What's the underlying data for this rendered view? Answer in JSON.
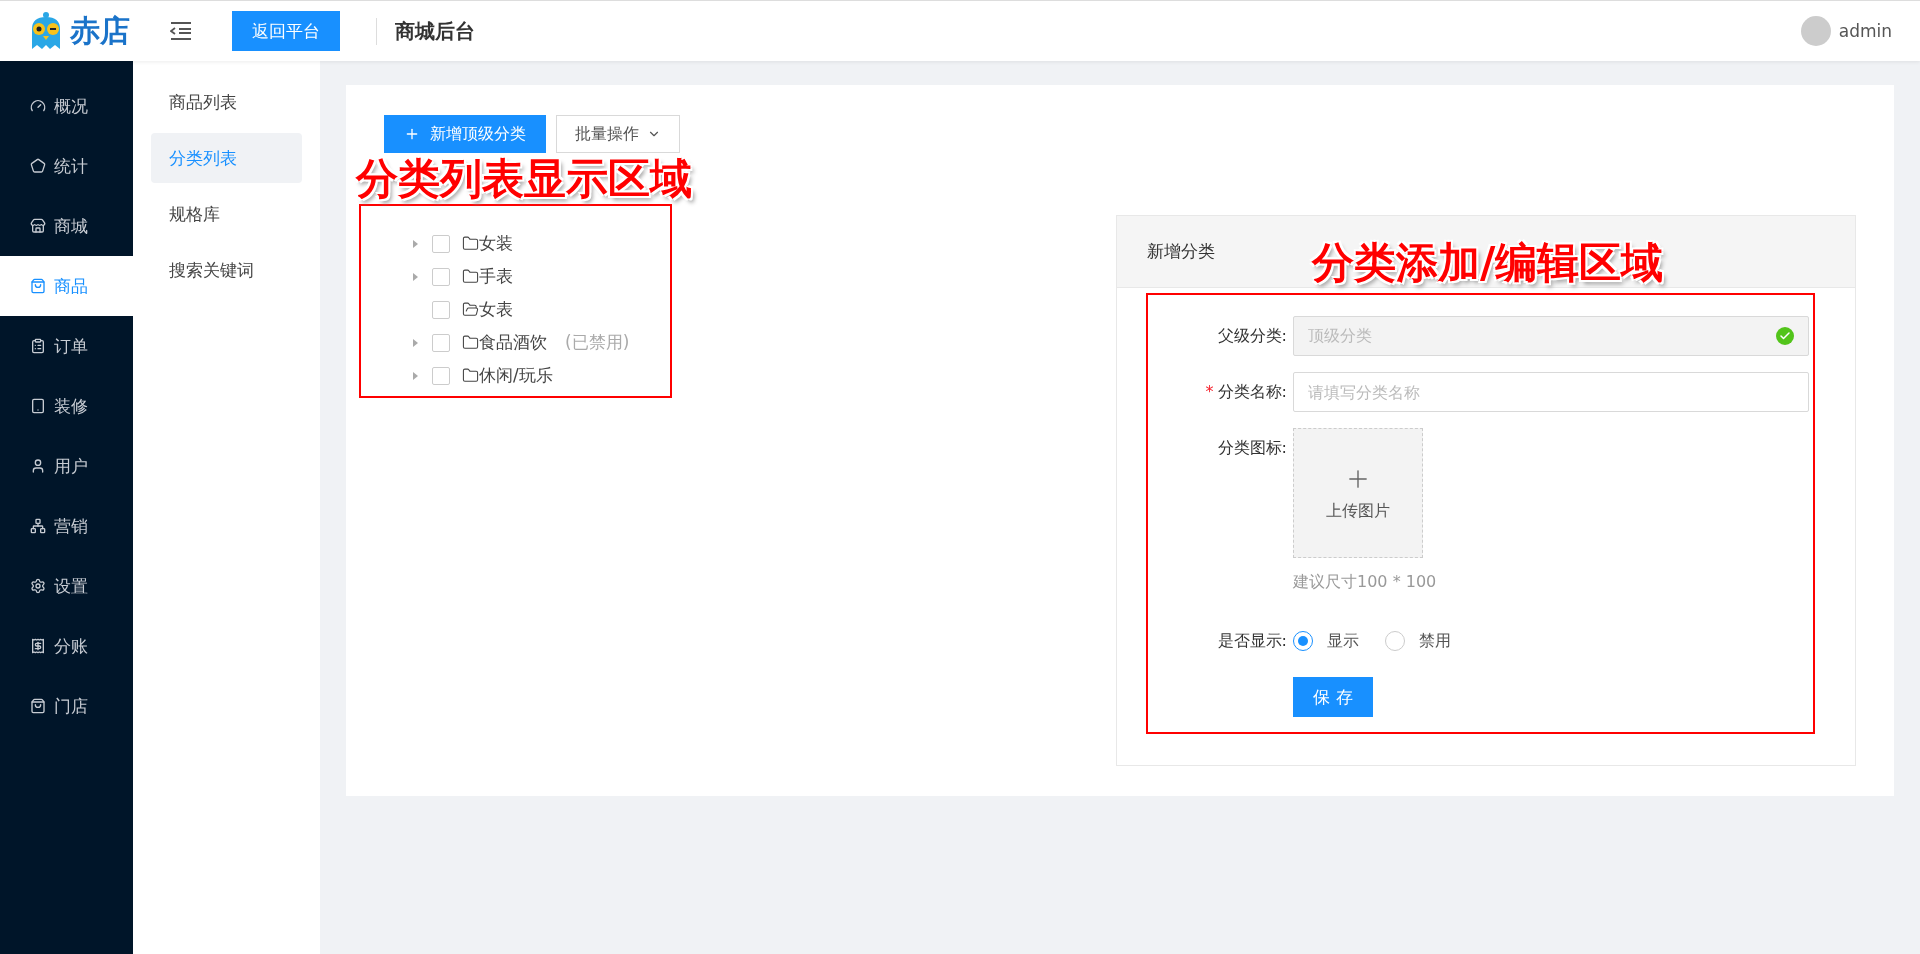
{
  "header": {
    "brand": "赤店",
    "back_button": "返回平台",
    "title": "商城后台",
    "user": "admin"
  },
  "sidebar": {
    "items": [
      {
        "label": "概况",
        "selected": false
      },
      {
        "label": "统计",
        "selected": false
      },
      {
        "label": "商城",
        "selected": false
      },
      {
        "label": "商品",
        "selected": true
      },
      {
        "label": "订单",
        "selected": false
      },
      {
        "label": "装修",
        "selected": false
      },
      {
        "label": "用户",
        "selected": false
      },
      {
        "label": "营销",
        "selected": false
      },
      {
        "label": "设置",
        "selected": false
      },
      {
        "label": "分账",
        "selected": false
      },
      {
        "label": "门店",
        "selected": false
      }
    ]
  },
  "submenu": {
    "items": [
      {
        "label": "商品列表",
        "selected": false
      },
      {
        "label": "分类列表",
        "selected": true
      },
      {
        "label": "规格库",
        "selected": false
      },
      {
        "label": "搜索关键词",
        "selected": false
      }
    ]
  },
  "toolbar": {
    "add_button": "新增顶级分类",
    "batch_button": "批量操作"
  },
  "tree": {
    "items": [
      {
        "label": "女装",
        "expandable": true,
        "checked": false
      },
      {
        "label": "手表",
        "expandable": true,
        "checked": false
      },
      {
        "label": "女表",
        "expandable": false,
        "checked": false
      },
      {
        "label": "食品酒饮",
        "note": "(已禁用)",
        "expandable": true,
        "checked": false
      },
      {
        "label": "休闲/玩乐",
        "expandable": true,
        "checked": false
      }
    ]
  },
  "form_panel": {
    "title": "新增分类",
    "parent": {
      "label": "父级分类:",
      "value": "顶级分类",
      "disabled": true,
      "validated": true
    },
    "name": {
      "label": "分类名称:",
      "required_mark": "*",
      "placeholder": "请填写分类名称"
    },
    "icon": {
      "label": "分类图标:",
      "upload": "上传图片",
      "hint": "建议尺寸100 * 100"
    },
    "visible": {
      "label": "是否显示:",
      "options": [
        {
          "label": "显示",
          "selected": true
        },
        {
          "label": "禁用",
          "selected": false
        }
      ]
    },
    "save_button": "保 存"
  },
  "annotations": [
    {
      "text": "分类列表显示区域"
    },
    {
      "text": "分类添加/编辑区域"
    }
  ]
}
